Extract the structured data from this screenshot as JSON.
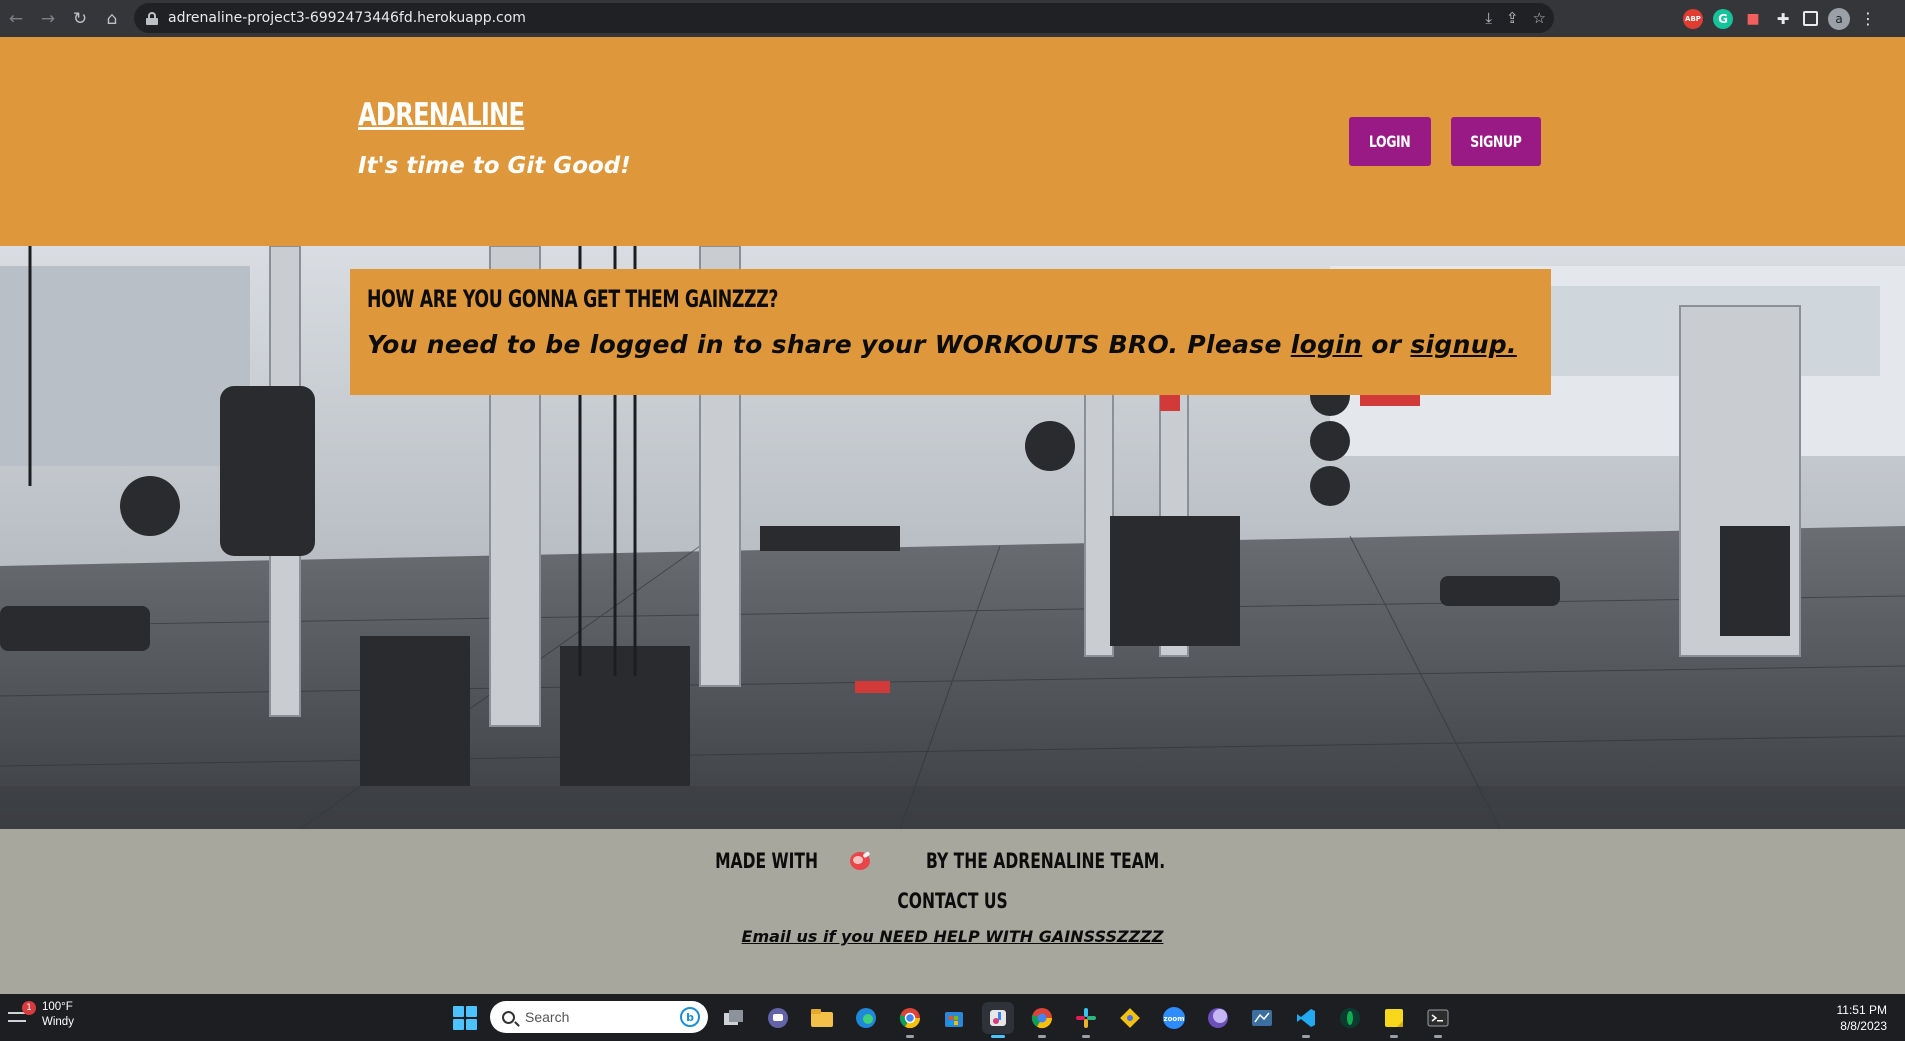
{
  "browser": {
    "url": "adrenaline-project3-6992473446fd.herokuapp.com",
    "profile_initial": "a",
    "extensions": [
      "ABP",
      "G"
    ]
  },
  "header": {
    "brand": "ADRENALINE",
    "tagline": "It's time to Git Good!",
    "login_label": "LOGIN",
    "signup_label": "SIGNUP"
  },
  "notice": {
    "title": "HOW ARE YOU GONNA GET THEM GAINZZZ?",
    "text_before": "You need to be logged in to share your WORKOUTS BRO. Please ",
    "login_link": "login",
    "text_middle": " or ",
    "signup_link": "signup."
  },
  "footer": {
    "made_with": "MADE WITH",
    "made_by": "BY THE ADRENALINE TEAM.",
    "contact_heading": "CONTACT US",
    "email_link": "Email us if you NEED HELP WITH GAINSSSZZZZ"
  },
  "taskbar": {
    "weather_temp": "100°F",
    "weather_desc": "Windy",
    "weather_badge": "1",
    "search_placeholder": "Search",
    "time": "11:51 PM",
    "date": "8/8/2023",
    "zoom_label": "zoom"
  },
  "colors": {
    "header_orange": "#de973a",
    "button_purple": "#991a85",
    "footer_gray": "#a7a79d"
  }
}
